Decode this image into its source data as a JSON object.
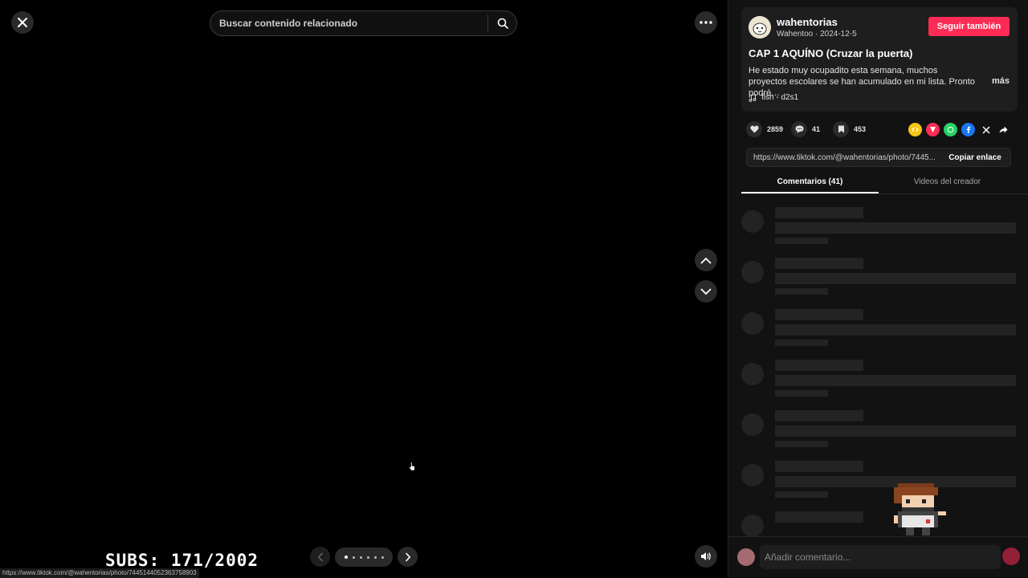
{
  "viewer": {
    "search_placeholder": "Buscar contenido relacionado",
    "status_url": "https://www.tiktok.com/@wahentorias/photo/7445144052363758903",
    "page_count": 6,
    "current_page": 1
  },
  "post": {
    "author": "wahentorias",
    "display_name": "Wahentoo",
    "date": "2024-12-5",
    "meta_separator": " · ",
    "follow_label": "Seguir también",
    "title": "CAP 1 AQUÍNO (Cruzar la puerta)",
    "description": "He estado muy ocupadito esta semana, muchos proyectos escolares se han acumulado en mi lista. Pronto podré…",
    "more_label": "más",
    "music": "fish - d2s1"
  },
  "stats": {
    "likes": "2859",
    "comments": "41",
    "saves": "453"
  },
  "share_icons": [
    "embed-icon",
    "friends-share-icon",
    "whatsapp-icon",
    "facebook-icon",
    "x-icon",
    "share-arrow-icon"
  ],
  "link": {
    "url": "https://www.tiktok.com/@wahentorias/photo/7445...",
    "copy_label": "Copiar enlace"
  },
  "tabs": [
    {
      "label": "Comentarios (41)",
      "active": true
    },
    {
      "label": "Videos del creador",
      "active": false
    }
  ],
  "comment_box": {
    "placeholder": "Añadir comentario..."
  },
  "overlay": {
    "subs_text": "SUBS: 171/2002"
  },
  "colors": {
    "accent": "#fe2c55",
    "panel": "#121212",
    "card": "#1e1e1e"
  }
}
